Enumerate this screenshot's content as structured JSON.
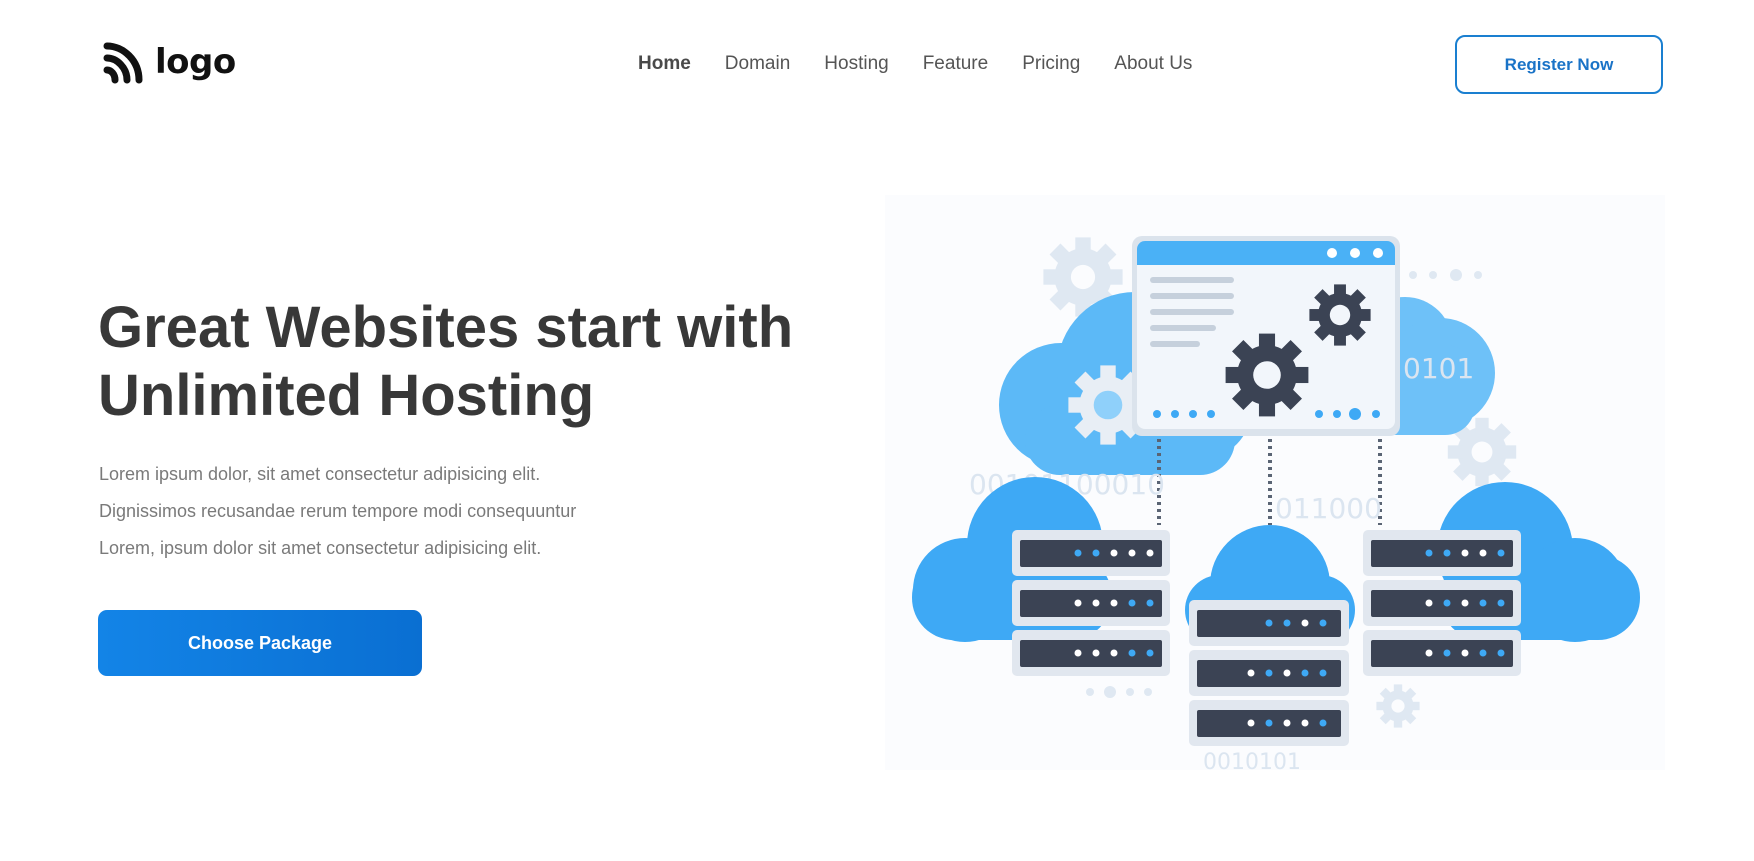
{
  "header": {
    "logo_text": "logo",
    "logo_icon": "wifi-signal-icon",
    "nav": [
      {
        "label": "Home",
        "active": true
      },
      {
        "label": "Domain",
        "active": false
      },
      {
        "label": "Hosting",
        "active": false
      },
      {
        "label": "Feature",
        "active": false
      },
      {
        "label": "Pricing",
        "active": false
      },
      {
        "label": "About Us",
        "active": false
      }
    ],
    "register_label": "Register Now"
  },
  "hero": {
    "title_lines": [
      "Great Websites start with",
      "Unlimited Hosting"
    ],
    "description_lines": [
      "Lorem ipsum dolor, sit amet consectetur adipisicing elit.",
      "Dignissimos recusandae rerum tempore modi consequuntur",
      "Lorem, ipsum dolor sit amet consectetur adipisicing elit."
    ],
    "cta_label": "Choose Package"
  },
  "illustration": {
    "binary_texts": [
      "0101",
      "00101100010",
      "011000",
      "0010101"
    ]
  },
  "colors": {
    "accent": "#1384e7",
    "register_border": "#1a7fd0",
    "title_text": "#383838",
    "body_text": "#7a7a7a",
    "nav_text": "#555555",
    "cloud_blue": "#3ea9f5",
    "server_dark": "#3b4354"
  }
}
